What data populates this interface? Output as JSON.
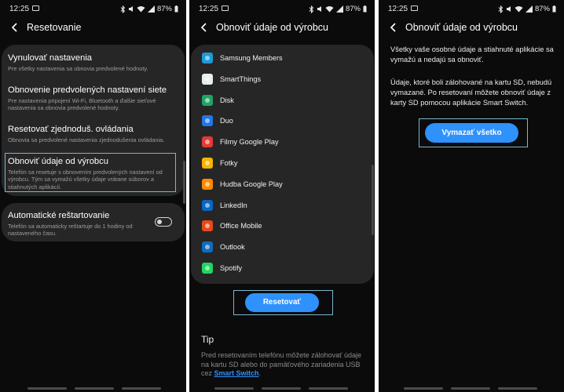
{
  "status_bar": {
    "time": "12:25",
    "battery": "87%"
  },
  "screen1": {
    "title": "Resetovanie",
    "items": [
      {
        "title": "Vynulovať nastavenia",
        "desc": "Pre všetky nastavenia sa obnovia predvolené hodnoty."
      },
      {
        "title": "Obnovenie predvolených nastavení siete",
        "desc": "Pre nastavenia pripojení Wi-Fi, Bluetooth a ďalšie sieťové nastavenia sa obnovia predvolené hodnoty."
      },
      {
        "title": "Resetovať zjednoduš. ovládania",
        "desc": "Obnovia sa predvolené nastavenia zjednodušenia ovládania."
      },
      {
        "title": "Obnoviť údaje od výrobcu",
        "desc": "Telefón sa resetuje s obnovením predvolených nastavení od výrobcu. Tým sa vymažú všetky údaje vrátane súborov a stiahnutých aplikácií."
      },
      {
        "title": "Automatické reštartovanie",
        "desc": "Telefón sa automaticky reštartuje do 1 hodiny od nastaveného času.",
        "toggle_on": false
      }
    ]
  },
  "screen2": {
    "title": "Obnoviť údaje od výrobcu",
    "apps": [
      {
        "name": "Samsung Members",
        "icon": "samsung-members-icon",
        "color": "#1d9bd8"
      },
      {
        "name": "SmartThings",
        "icon": "smartthings-icon",
        "color": "#e9eef2"
      },
      {
        "name": "Disk",
        "icon": "google-drive-icon",
        "color": "#1fa463"
      },
      {
        "name": "Duo",
        "icon": "google-duo-icon",
        "color": "#2178e8"
      },
      {
        "name": "Filmy Google Play",
        "icon": "play-movies-icon",
        "color": "#e53935"
      },
      {
        "name": "Fotky",
        "icon": "google-photos-icon",
        "color": "#f4b400"
      },
      {
        "name": "Hudba Google Play",
        "icon": "play-music-icon",
        "color": "#ff8a00"
      },
      {
        "name": "LinkedIn",
        "icon": "linkedin-icon",
        "color": "#0a66c2"
      },
      {
        "name": "Office Mobile",
        "icon": "office-mobile-icon",
        "color": "#e64a19"
      },
      {
        "name": "Outlook",
        "icon": "outlook-icon",
        "color": "#0f6cbd"
      },
      {
        "name": "Spotify",
        "icon": "spotify-icon",
        "color": "#1ed760"
      }
    ],
    "reset_button": "Resetovať",
    "tip_title": "Tip",
    "tip_text": "Pred resetovaním telefónu môžete zálohovať údaje na kartu SD alebo do pamäťového zariadenia USB cez",
    "tip_link": "Smart Switch",
    "tip_end": "."
  },
  "screen3": {
    "title": "Obnoviť údaje od výrobcu",
    "para1": "Všetky vaše osobné údaje a stiahnuté aplikácie sa vymažú a nedajú sa obnoviť.",
    "para2": "Údaje, ktoré boli zálohované na kartu SD, nebudú vymazané. Po resetovaní môžete obnoviť údaje z karty SD pomocou aplikácie Smart Switch.",
    "delete_button": "Vymazať všetko"
  },
  "colors": {
    "accent": "#2e91fc",
    "highlight": "#79b7d1",
    "background": "#0b0b0b",
    "card": "#262626"
  }
}
